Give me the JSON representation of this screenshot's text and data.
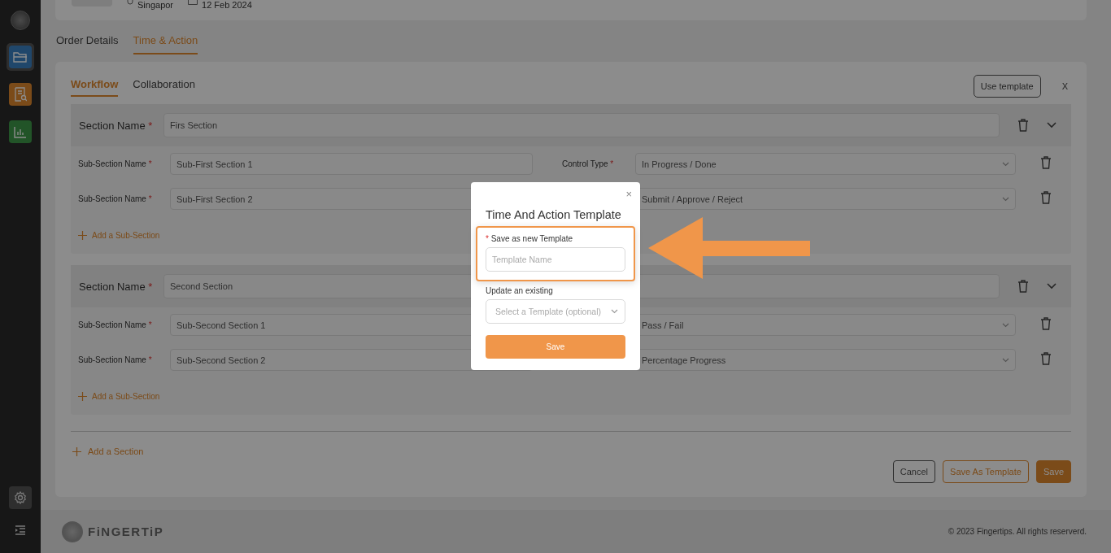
{
  "sidebar": {
    "items": [
      {
        "kind": "folder",
        "selected": true
      },
      {
        "kind": "report",
        "selected": false
      },
      {
        "kind": "chart",
        "selected": false
      }
    ],
    "bottom_items": [
      {
        "kind": "settings"
      },
      {
        "kind": "menu"
      }
    ]
  },
  "header": {
    "location": "Singapor",
    "date": "12 Feb 2024"
  },
  "tabs": [
    {
      "label": "Order Details",
      "selected": false
    },
    {
      "label": "Time & Action",
      "selected": true
    }
  ],
  "subtabs": [
    {
      "label": "Workflow",
      "selected": true
    },
    {
      "label": "Collaboration",
      "selected": false
    }
  ],
  "use_template_button": "Use template",
  "close_button": "X",
  "sections": [
    {
      "label": "Section Name",
      "required_mark": "*",
      "value": "Firs Section",
      "add_label": "Add a Sub-Section",
      "subsections": [
        {
          "label": "Sub-Section Name",
          "required_mark": "*",
          "value": "Sub-First Section 1",
          "control_label": "Control Type",
          "control_required_mark": "*",
          "control_value": "In Progress / Done"
        },
        {
          "label": "Sub-Section Name",
          "required_mark": "*",
          "value": "Sub-First Section 2",
          "control_value": "Submit / Approve / Reject"
        }
      ]
    },
    {
      "label": "Section Name",
      "required_mark": "*",
      "value": "Second Section",
      "add_label": "Add a Sub-Section",
      "subsections": [
        {
          "label": "Sub-Section Name",
          "required_mark": "*",
          "value": "Sub-Second Section 1",
          "control_value": "Pass / Fail"
        },
        {
          "label": "Sub-Section Name",
          "required_mark": "*",
          "value": "Sub-Second Section 2",
          "control_value": "Percentage Progress"
        }
      ]
    }
  ],
  "add_section": "Add a Section",
  "actions": [
    {
      "label": "Cancel",
      "kind": "cancel"
    },
    {
      "label": "Save As Template",
      "kind": "outline"
    },
    {
      "label": "Save",
      "kind": "primary"
    }
  ],
  "footer": {
    "brand": "FiNGERTiP",
    "copyright": "© 2023 Fingertips. All rights reserverd."
  },
  "modal": {
    "title": "Time And Action Template",
    "close": "×",
    "new_label": "Save as new Template",
    "new_required_mark": "*",
    "new_placeholder": "Template Name",
    "existing_label": "Update an existing",
    "existing_placeholder": "Select a Template (optional)",
    "save": "Save"
  }
}
